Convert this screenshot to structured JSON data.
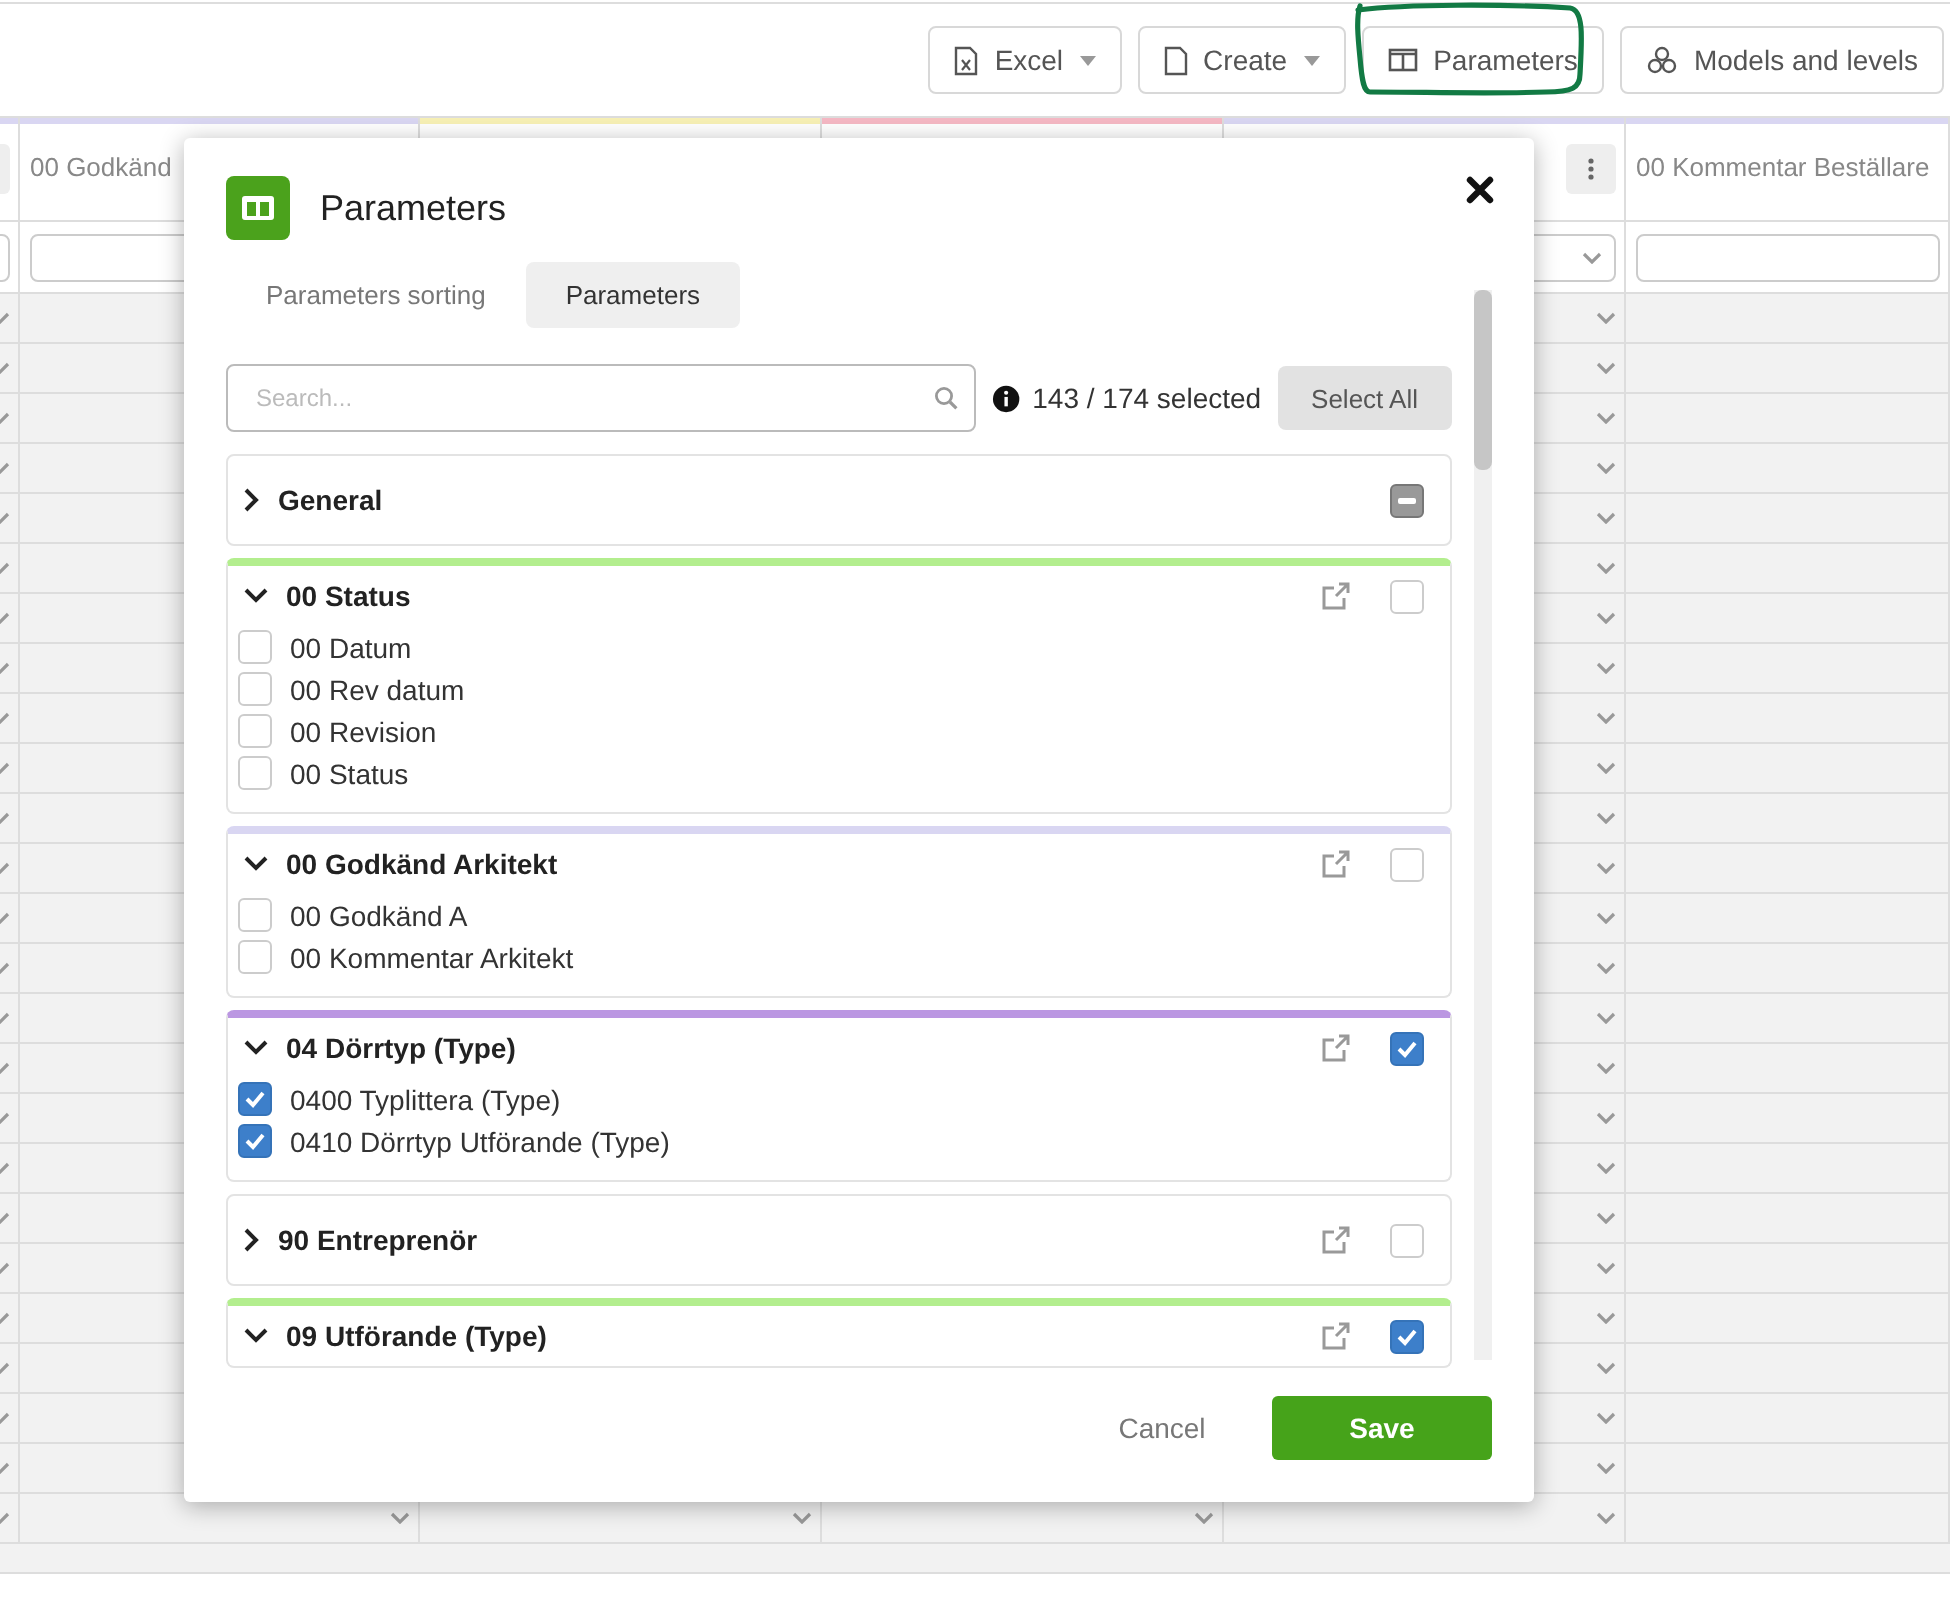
{
  "toolbar": {
    "buttons": [
      {
        "label": "Excel",
        "kind": "excel",
        "dropdown": true,
        "highlighted": false
      },
      {
        "label": "Create",
        "kind": "file",
        "dropdown": true,
        "highlighted": false
      },
      {
        "label": "Parameters",
        "kind": "columns",
        "dropdown": false,
        "highlighted": true
      },
      {
        "label": "Models and levels",
        "kind": "cubes",
        "dropdown": false,
        "highlighted": false
      }
    ]
  },
  "table": {
    "columns": [
      {
        "color": "#d9d6f2",
        "menu": true,
        "kind": "text",
        "dropdown": true
      },
      {
        "header": "00 Godkänd",
        "color": "#d9d6f2",
        "menu": false,
        "kind": "text",
        "dropdown": true
      },
      {
        "color": "#f7f0b5",
        "menu": false,
        "dropdown": true
      },
      {
        "color": "#f5b8c4",
        "menu": false,
        "dropdown": true
      },
      {
        "color": "#d9d6f2",
        "menu": true,
        "kind": "select",
        "dropdown": true
      },
      {
        "header": "00 Kommentar Beställare",
        "color": "#d9d6f2",
        "menu": false,
        "kind": "text",
        "dropdown": false
      }
    ]
  },
  "dialog": {
    "title": "Parameters",
    "tabs": [
      {
        "label": "Parameters sorting",
        "selected": false
      },
      {
        "label": "Parameters",
        "selected": true
      }
    ],
    "search": {
      "placeholder": "Search..."
    },
    "selection_count": "143 / 174 selected",
    "select_all": "Select All",
    "groups": [
      {
        "title": "General",
        "kind": "fixed",
        "expanded": false,
        "checked": false,
        "indeterminate": true
      },
      {
        "title": "00 Status",
        "kind": "category",
        "color": "#b3ee8e",
        "expanded": true,
        "checked": false,
        "indeterminate": false,
        "items": [
          {
            "label": "00 Datum",
            "checked": false
          },
          {
            "label": "00 Rev datum",
            "checked": false
          },
          {
            "label": "00 Revision",
            "checked": false
          },
          {
            "label": "00 Status",
            "checked": false
          }
        ]
      },
      {
        "title": "00 Godkänd Arkitekt",
        "kind": "category",
        "color": "#d9d6f2",
        "expanded": true,
        "checked": false,
        "indeterminate": false,
        "items": [
          {
            "label": "00 Godkänd A",
            "checked": false
          },
          {
            "label": "00 Kommentar Arkitekt",
            "checked": false
          }
        ]
      },
      {
        "title": "04 Dörrtyp (Type)",
        "kind": "category",
        "color": "#bb97e2",
        "expanded": true,
        "checked": true,
        "indeterminate": false,
        "items": [
          {
            "label": "0400 Typlittera (Type)",
            "checked": true
          },
          {
            "label": "0410 Dörrtyp Utförande (Type)",
            "checked": true
          }
        ]
      },
      {
        "title": "90 Entreprenör",
        "kind": "category",
        "expanded": false,
        "checked": false,
        "indeterminate": false
      },
      {
        "title": "09 Utförande (Type)",
        "kind": "category",
        "color": "#b3ee8e",
        "expanded": true,
        "checked": true,
        "indeterminate": false
      }
    ],
    "buttons": {
      "cancel": "Cancel",
      "save": "Save"
    }
  }
}
